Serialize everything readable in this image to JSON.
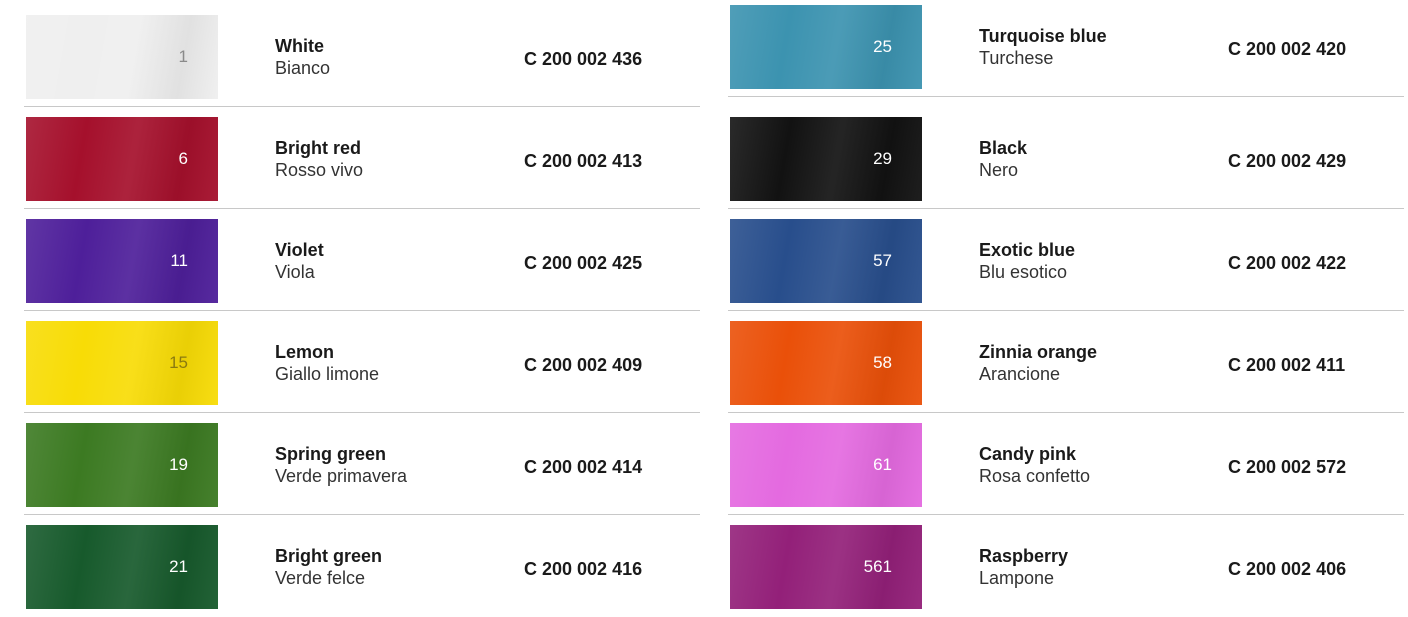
{
  "left_column": [
    {
      "number": "1",
      "name_en": "White",
      "name_it": "Bianco",
      "code": "C 200 002 436",
      "color": "#efefef",
      "tone": "light"
    },
    {
      "number": "6",
      "name_en": "Bright red",
      "name_it": "Rosso vivo",
      "code": "C 200 002 413",
      "color": "#a5102c",
      "tone": "dark"
    },
    {
      "number": "11",
      "name_en": "Violet",
      "name_it": "Viola",
      "code": "C 200 002 425",
      "color": "#4e1f9a",
      "tone": "dark"
    },
    {
      "number": "15",
      "name_en": "Lemon",
      "name_it": "Giallo limone",
      "code": "C 200 002 409",
      "color": "#f8dc06",
      "tone": "yellow"
    },
    {
      "number": "19",
      "name_en": "Spring green",
      "name_it": "Verde primavera",
      "code": "C 200 002 414",
      "color": "#3c7a22",
      "tone": "dark"
    },
    {
      "number": "21",
      "name_en": "Bright green",
      "name_it": "Verde felce",
      "code": "C 200 002 416",
      "color": "#175a2c",
      "tone": "dark"
    }
  ],
  "right_column": [
    {
      "number": "25",
      "name_en": "Turquoise blue",
      "name_it": "Turchese",
      "code": "C 200 002 420",
      "color": "#3c93b0",
      "tone": "dark"
    },
    {
      "number": "29",
      "name_en": "Black",
      "name_it": "Nero",
      "code": "C 200 002 429",
      "color": "#121212",
      "tone": "dark"
    },
    {
      "number": "57",
      "name_en": "Exotic blue",
      "name_it": "Blu esotico",
      "code": "C 200 002 422",
      "color": "#284e8c",
      "tone": "dark"
    },
    {
      "number": "58",
      "name_en": "Zinnia orange",
      "name_it": "Arancione",
      "code": "C 200 002 411",
      "color": "#ea5009",
      "tone": "dark"
    },
    {
      "number": "61",
      "name_en": "Candy pink",
      "name_it": "Rosa confetto",
      "code": "C 200 002 572",
      "color": "#e46ae0",
      "tone": "dark"
    },
    {
      "number": "561",
      "name_en": "Raspberry",
      "name_it": "Lampone",
      "code": "C 200 002 406",
      "color": "#932079",
      "tone": "dark"
    }
  ]
}
